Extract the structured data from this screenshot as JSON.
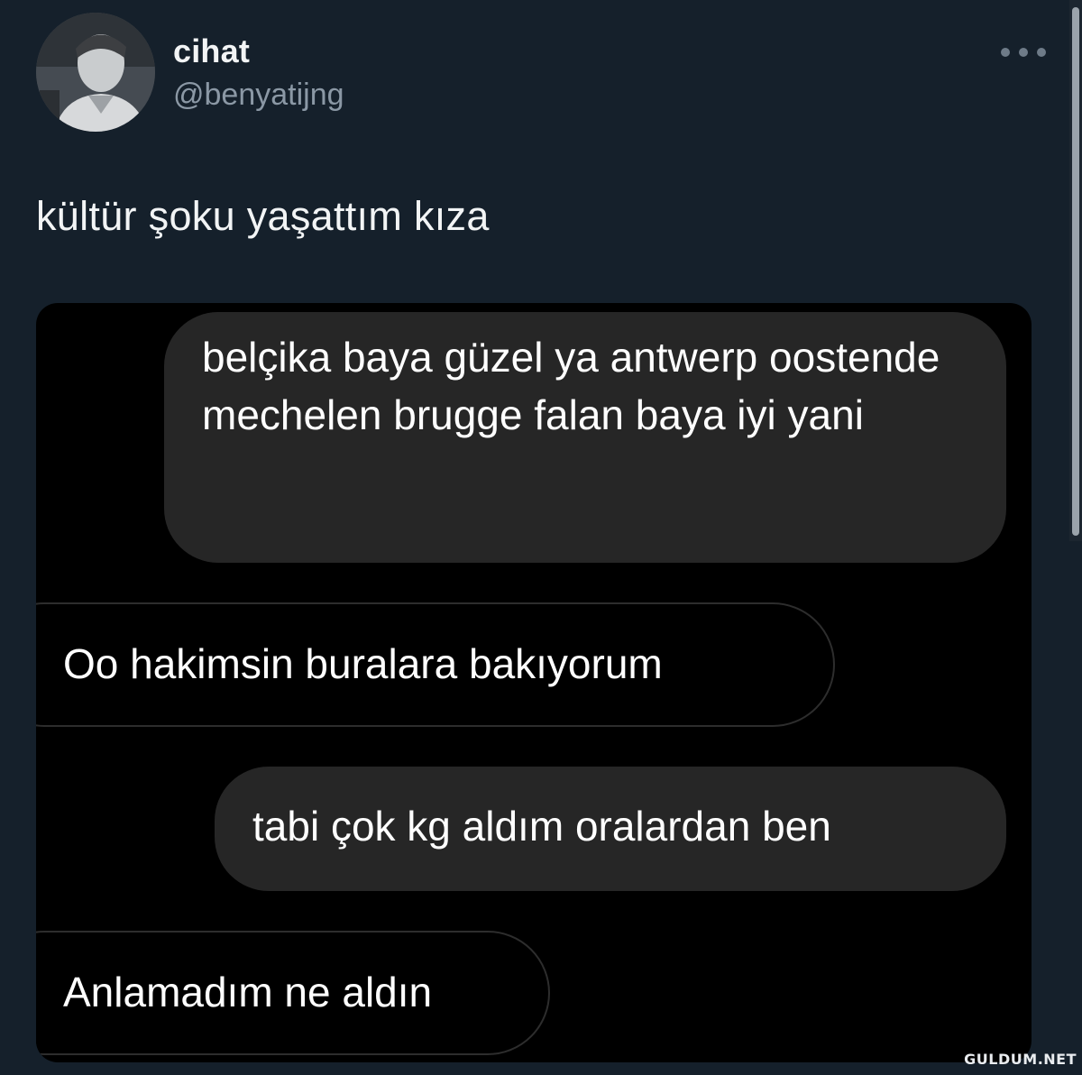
{
  "tweet": {
    "author_name": "cihat",
    "author_handle": "@benyatijng",
    "text": "kültür şoku yaşattım kıza",
    "more_icon": "more-horizontal-icon",
    "avatar": "user-avatar"
  },
  "chat": {
    "messages": [
      {
        "side": "sent",
        "text": "belçika baya güzel ya antwerp oostende mechelen brugge falan baya iyi yani"
      },
      {
        "side": "received",
        "text": "Oo hakimsin buralara bakıyorum"
      },
      {
        "side": "sent",
        "text": "tabi çok kg aldım oralardan ben"
      },
      {
        "side": "received",
        "text": "Anlamadım ne aldın"
      }
    ]
  },
  "watermark": "GULDUM.NET",
  "colors": {
    "background": "#15202b",
    "media_background": "#000000",
    "sent_bubble": "#262626",
    "received_bubble_border": "#2d2d2d",
    "handle": "#8b98a5"
  }
}
